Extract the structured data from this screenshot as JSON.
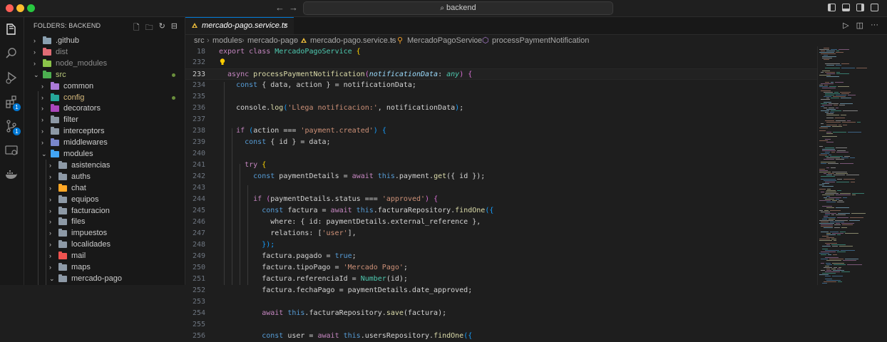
{
  "window": {
    "title": "backend"
  },
  "activity_bar": {
    "items": [
      {
        "name": "explorer-icon"
      },
      {
        "name": "search-icon"
      },
      {
        "name": "run-debug-icon"
      },
      {
        "name": "extensions-icon",
        "badge": "1"
      },
      {
        "name": "source-control-icon",
        "badge": "1"
      },
      {
        "name": "remote-explorer-icon"
      },
      {
        "name": "docker-icon"
      }
    ]
  },
  "sidebar": {
    "title": "FOLDERS: BACKEND",
    "tree": [
      {
        "label": ".github",
        "depth": 0,
        "expanded": false,
        "icon_color": "#8aa0b0",
        "label_color": "#cccccc"
      },
      {
        "label": "dist",
        "depth": 0,
        "expanded": false,
        "icon_color": "#e06c75",
        "label_color": "#8b8b8b"
      },
      {
        "label": "node_modules",
        "depth": 0,
        "expanded": false,
        "icon_color": "#8bc34a",
        "label_color": "#8b8b8b"
      },
      {
        "label": "src",
        "depth": 0,
        "expanded": true,
        "icon_color": "#4caf50",
        "label_color": "#b8c87a",
        "modified": true
      },
      {
        "label": "common",
        "depth": 1,
        "expanded": false,
        "icon_color": "#ab7ad8",
        "label_color": "#cccccc"
      },
      {
        "label": "config",
        "depth": 1,
        "expanded": false,
        "icon_color": "#26a69a",
        "label_color": "#d7ba7d",
        "modified": true
      },
      {
        "label": "decorators",
        "depth": 1,
        "expanded": false,
        "icon_color": "#ab47bc",
        "label_color": "#cccccc"
      },
      {
        "label": "filter",
        "depth": 1,
        "expanded": false,
        "icon_color": "#8d99a6",
        "label_color": "#cccccc"
      },
      {
        "label": "interceptors",
        "depth": 1,
        "expanded": false,
        "icon_color": "#8d99a6",
        "label_color": "#cccccc"
      },
      {
        "label": "middlewares",
        "depth": 1,
        "expanded": false,
        "icon_color": "#7986cb",
        "label_color": "#cccccc"
      },
      {
        "label": "modules",
        "depth": 1,
        "expanded": true,
        "icon_color": "#42a5f5",
        "label_color": "#cccccc"
      },
      {
        "label": "asistencias",
        "depth": 2,
        "expanded": false,
        "icon_color": "#8d99a6",
        "label_color": "#cccccc"
      },
      {
        "label": "auths",
        "depth": 2,
        "expanded": false,
        "icon_color": "#8d99a6",
        "label_color": "#cccccc"
      },
      {
        "label": "chat",
        "depth": 2,
        "expanded": false,
        "icon_color": "#ffa726",
        "label_color": "#cccccc"
      },
      {
        "label": "equipos",
        "depth": 2,
        "expanded": false,
        "icon_color": "#8d99a6",
        "label_color": "#cccccc"
      },
      {
        "label": "facturacion",
        "depth": 2,
        "expanded": false,
        "icon_color": "#8d99a6",
        "label_color": "#cccccc"
      },
      {
        "label": "files",
        "depth": 2,
        "expanded": false,
        "icon_color": "#8d99a6",
        "label_color": "#cccccc"
      },
      {
        "label": "impuestos",
        "depth": 2,
        "expanded": false,
        "icon_color": "#8d99a6",
        "label_color": "#cccccc"
      },
      {
        "label": "localidades",
        "depth": 2,
        "expanded": false,
        "icon_color": "#8d99a6",
        "label_color": "#cccccc"
      },
      {
        "label": "mail",
        "depth": 2,
        "expanded": false,
        "icon_color": "#ef5350",
        "label_color": "#cccccc"
      },
      {
        "label": "maps",
        "depth": 2,
        "expanded": false,
        "icon_color": "#8d99a6",
        "label_color": "#cccccc"
      },
      {
        "label": "mercado-pago",
        "depth": 2,
        "expanded": true,
        "icon_color": "#8d99a6",
        "label_color": "#cccccc"
      }
    ]
  },
  "editor": {
    "tab": {
      "label": "mercado-pago.service.ts",
      "close": "×"
    },
    "breadcrumb": [
      "src",
      "modules",
      "mercado-pago",
      "mercado-pago.service.ts",
      "MercadoPagoService",
      "processPaymentNotification"
    ],
    "lines": [
      {
        "n": "18",
        "tokens": [
          [
            "export class ",
            "kw"
          ],
          [
            "MercadoPagoService",
            "ty"
          ],
          [
            " {",
            "br1"
          ]
        ]
      },
      {
        "n": "232",
        "tokens": []
      },
      {
        "n": "233",
        "tokens": [
          [
            "  async ",
            "kw"
          ],
          [
            "processPaymentNotification",
            "fn"
          ],
          [
            "(",
            "br2"
          ],
          [
            "notificationData",
            "vr it"
          ],
          [
            ": ",
            ""
          ],
          [
            "any",
            "ty it"
          ],
          [
            ") {",
            "br2"
          ]
        ]
      },
      {
        "n": "234",
        "tokens": [
          [
            "    const ",
            "kwb"
          ],
          [
            "{ data, action } = notificationData;",
            ""
          ]
        ]
      },
      {
        "n": "235",
        "tokens": []
      },
      {
        "n": "236",
        "tokens": [
          [
            "    console.",
            ""
          ],
          [
            "log",
            "fn"
          ],
          [
            "(",
            "br3"
          ],
          [
            "'Llega notificacion:'",
            "str"
          ],
          [
            ", notificationData",
            ""
          ],
          [
            ")",
            "br3"
          ],
          [
            ";",
            ""
          ]
        ]
      },
      {
        "n": "237",
        "tokens": []
      },
      {
        "n": "238",
        "tokens": [
          [
            "    if ",
            "kw"
          ],
          [
            "(",
            "br3"
          ],
          [
            "action === ",
            ""
          ],
          [
            "'payment.created'",
            "str"
          ],
          [
            ") {",
            "br3"
          ]
        ]
      },
      {
        "n": "239",
        "tokens": [
          [
            "      const ",
            "kwb"
          ],
          [
            "{ id } = data;",
            ""
          ]
        ]
      },
      {
        "n": "240",
        "tokens": []
      },
      {
        "n": "241",
        "tokens": [
          [
            "      try ",
            "kw"
          ],
          [
            "{",
            "br1"
          ]
        ]
      },
      {
        "n": "242",
        "tokens": [
          [
            "        const ",
            "kwb"
          ],
          [
            "paymentDetails = ",
            ""
          ],
          [
            "await ",
            "kw"
          ],
          [
            "this",
            "kwb"
          ],
          [
            ".payment.",
            ""
          ],
          [
            "get",
            "fn"
          ],
          [
            "({ id });",
            ""
          ]
        ]
      },
      {
        "n": "243",
        "tokens": []
      },
      {
        "n": "244",
        "tokens": [
          [
            "        if ",
            "kw"
          ],
          [
            "(",
            "br2"
          ],
          [
            "paymentDetails.status === ",
            ""
          ],
          [
            "'approved'",
            "str"
          ],
          [
            ") {",
            "br2"
          ]
        ]
      },
      {
        "n": "245",
        "tokens": [
          [
            "          const ",
            "kwb"
          ],
          [
            "factura = ",
            ""
          ],
          [
            "await ",
            "kw"
          ],
          [
            "this",
            "kwb"
          ],
          [
            ".facturaRepository.",
            ""
          ],
          [
            "findOne",
            "fn"
          ],
          [
            "({",
            "br3"
          ]
        ]
      },
      {
        "n": "246",
        "tokens": [
          [
            "            where: { id: paymentDetails.external_reference },",
            ""
          ]
        ]
      },
      {
        "n": "247",
        "tokens": [
          [
            "            relations: [",
            ""
          ],
          [
            "'user'",
            "str"
          ],
          [
            "],",
            ""
          ]
        ]
      },
      {
        "n": "248",
        "tokens": [
          [
            "          });",
            "br3"
          ]
        ]
      },
      {
        "n": "249",
        "tokens": [
          [
            "          factura.pagado = ",
            ""
          ],
          [
            "true",
            "kwb"
          ],
          [
            ";",
            ""
          ]
        ]
      },
      {
        "n": "250",
        "tokens": [
          [
            "          factura.tipoPago = ",
            ""
          ],
          [
            "'Mercado Pago'",
            "str"
          ],
          [
            ";",
            ""
          ]
        ]
      },
      {
        "n": "251",
        "tokens": [
          [
            "          factura.referenciaId = ",
            ""
          ],
          [
            "Number",
            "ty"
          ],
          [
            "(id);",
            ""
          ]
        ]
      },
      {
        "n": "252",
        "tokens": [
          [
            "          factura.fechaPago = paymentDetails.date_approved;",
            ""
          ]
        ]
      },
      {
        "n": "253",
        "tokens": []
      },
      {
        "n": "254",
        "tokens": [
          [
            "          await ",
            "kw"
          ],
          [
            "this",
            "kwb"
          ],
          [
            ".facturaRepository.",
            ""
          ],
          [
            "save",
            "fn"
          ],
          [
            "(factura);",
            ""
          ]
        ]
      },
      {
        "n": "255",
        "tokens": []
      },
      {
        "n": "256",
        "tokens": [
          [
            "          const ",
            "kwb"
          ],
          [
            "user = ",
            ""
          ],
          [
            "await ",
            "kw"
          ],
          [
            "this",
            "kwb"
          ],
          [
            ".usersRepository.",
            ""
          ],
          [
            "findOne",
            "fn"
          ],
          [
            "({",
            "br3"
          ]
        ]
      }
    ],
    "current_line": "233"
  },
  "colors": {
    "accent": "#0078d4",
    "background": "#1e1e1e",
    "sidebar": "#181818"
  }
}
